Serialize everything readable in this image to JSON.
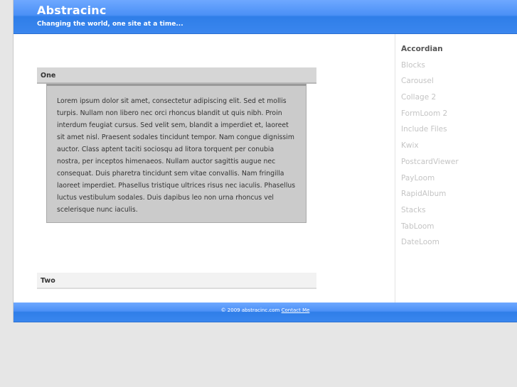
{
  "header": {
    "title": "Abstracinc",
    "tagline": "Changing the world, one site at a time..."
  },
  "accordion": {
    "sections": [
      {
        "title": "One",
        "body": "Lorem ipsum dolor sit amet, consectetur adipiscing elit. Sed et mollis turpis. Nullam non libero nec orci rhoncus blandit ut quis nibh. Proin interdum feugiat cursus. Sed velit sem, blandit a imperdiet et, laoreet sit amet nisl. Praesent sodales tincidunt tempor. Nam congue dignissim auctor. Class aptent taciti sociosqu ad litora torquent per conubia nostra, per inceptos himenaeos. Nullam auctor sagittis augue nec consequat. Duis pharetra tincidunt sem vitae convallis. Nam fringilla laoreet imperdiet. Phasellus tristique ultrices risus nec iaculis. Phasellus luctus vestibulum sodales. Duis dapibus leo non urna rhoncus vel scelerisque nunc iaculis."
      },
      {
        "title": "Two"
      }
    ]
  },
  "sidebar": {
    "items": [
      {
        "label": "Accordian"
      },
      {
        "label": "Blocks"
      },
      {
        "label": "Carousel"
      },
      {
        "label": "Collage 2"
      },
      {
        "label": "FormLoom 2"
      },
      {
        "label": "Include Files"
      },
      {
        "label": "Kwix"
      },
      {
        "label": "PostcardViewer"
      },
      {
        "label": "PayLoom"
      },
      {
        "label": "RapidAlbum"
      },
      {
        "label": "Stacks"
      },
      {
        "label": "TabLoom"
      },
      {
        "label": "DateLoom"
      }
    ]
  },
  "footer": {
    "copyright": "© 2009 abstracinc.com",
    "contact_label": "Contact Me"
  },
  "colors": {
    "header_blue": "#3a86ee",
    "page_background": "#e6e6e6",
    "panel_gray": "#cbcbcb"
  }
}
